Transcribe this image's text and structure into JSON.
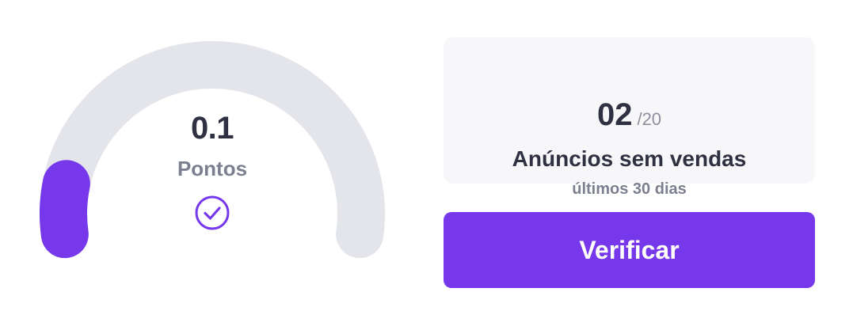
{
  "score": {
    "value": "0.1",
    "label": "Pontos",
    "fraction": 0.1,
    "status_icon": "check-circle-icon"
  },
  "stats": {
    "count": "02",
    "total": "/20",
    "title": "Anúncios sem vendas",
    "subtitle": "últimos 30 dias"
  },
  "action": {
    "label": "Verificar"
  },
  "colors": {
    "accent": "#7638ea",
    "track": "#e3e5ea",
    "text_primary": "#2f3142",
    "text_secondary": "#7c7f8f",
    "card_background": "#f7f7f9"
  }
}
